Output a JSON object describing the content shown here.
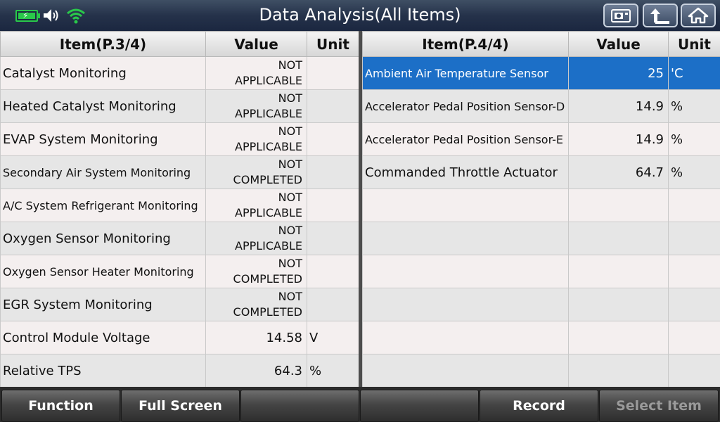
{
  "header": {
    "title": "Data Analysis(All Items)",
    "icons": [
      "battery-charging-icon",
      "speaker-icon",
      "wifi-icon",
      "screenshot-icon",
      "back-up-arrow-icon",
      "home-icon"
    ]
  },
  "left_table": {
    "headers": {
      "item": "Item(P.3/4)",
      "value": "Value",
      "unit": "Unit"
    },
    "rows": [
      {
        "item": "Catalyst Monitoring",
        "value_line1": "NOT",
        "value_line2": "APPLICABLE",
        "unit": ""
      },
      {
        "item": "Heated Catalyst Monitoring",
        "value_line1": "NOT",
        "value_line2": "APPLICABLE",
        "unit": ""
      },
      {
        "item": "EVAP System Monitoring",
        "value_line1": "NOT",
        "value_line2": "APPLICABLE",
        "unit": ""
      },
      {
        "item": "Secondary Air System Monitoring",
        "value_line1": "NOT",
        "value_line2": "COMPLETED",
        "unit": ""
      },
      {
        "item": "A/C System Refrigerant Monitoring",
        "value_line1": "NOT",
        "value_line2": "APPLICABLE",
        "unit": ""
      },
      {
        "item": "Oxygen Sensor Monitoring",
        "value_line1": "NOT",
        "value_line2": "APPLICABLE",
        "unit": ""
      },
      {
        "item": "Oxygen Sensor Heater Monitoring",
        "value_line1": "NOT",
        "value_line2": "COMPLETED",
        "unit": ""
      },
      {
        "item": "EGR System Monitoring",
        "value_line1": "NOT",
        "value_line2": "COMPLETED",
        "unit": ""
      },
      {
        "item": "Control Module Voltage",
        "value": "14.58",
        "unit": "V"
      },
      {
        "item": "Relative TPS",
        "value": "64.3",
        "unit": "%"
      }
    ]
  },
  "right_table": {
    "headers": {
      "item": "Item(P.4/4)",
      "value": "Value",
      "unit": "Unit"
    },
    "rows": [
      {
        "item": "Ambient Air Temperature Sensor",
        "value": "25",
        "unit": "'C",
        "selected": true
      },
      {
        "item": "Accelerator Pedal Position Sensor-D",
        "value": "14.9",
        "unit": "%"
      },
      {
        "item": "Accelerator Pedal Position Sensor-E",
        "value": "14.9",
        "unit": "%"
      },
      {
        "item": "Commanded Throttle Actuator",
        "value": "64.7",
        "unit": "%"
      },
      {
        "item": "",
        "value": "",
        "unit": ""
      },
      {
        "item": "",
        "value": "",
        "unit": ""
      },
      {
        "item": "",
        "value": "",
        "unit": ""
      },
      {
        "item": "",
        "value": "",
        "unit": ""
      },
      {
        "item": "",
        "value": "",
        "unit": ""
      },
      {
        "item": "",
        "value": "",
        "unit": ""
      }
    ]
  },
  "bottom_bar": {
    "function_label": "Function",
    "full_screen_label": "Full Screen",
    "empty1_label": "",
    "empty2_label": "",
    "record_label": "Record",
    "select_item_label": "Select Item"
  },
  "colors": {
    "selected_row": "#1c6fc7",
    "header_bar": "#25324a",
    "battery": "#29c94a"
  }
}
